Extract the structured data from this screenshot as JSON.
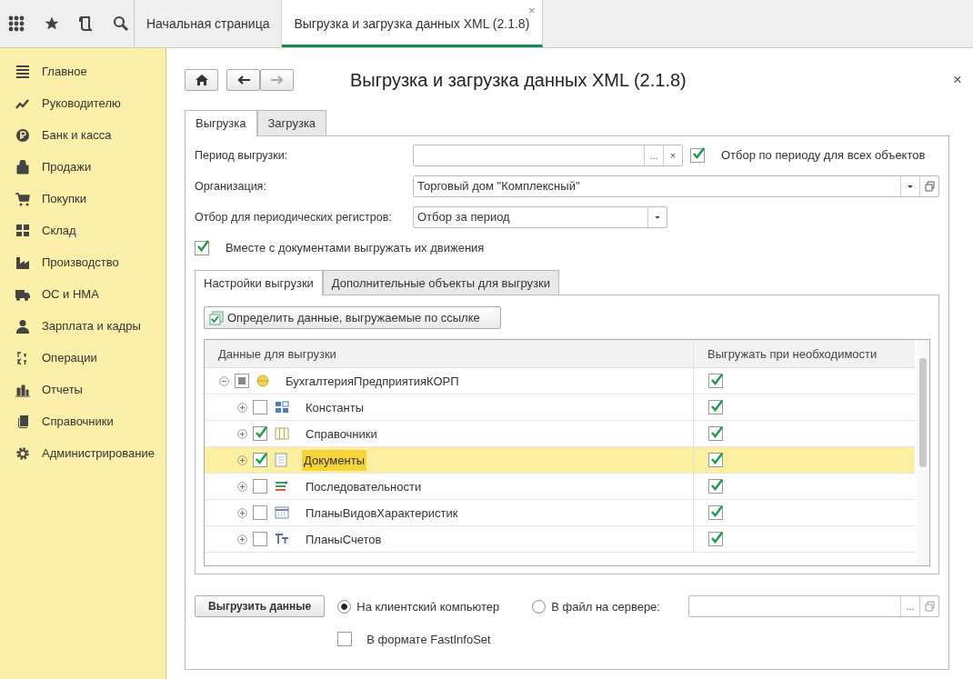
{
  "tabs": [
    {
      "label": "Начальная страница",
      "selected": false
    },
    {
      "label": "Выгрузка и загрузка данных XML (2.1.8)",
      "selected": true,
      "close": "×"
    }
  ],
  "sidebar": {
    "items": [
      {
        "label": "Главное",
        "kind": "menu"
      },
      {
        "label": "Руководителю",
        "kind": "trend"
      },
      {
        "label": "Банк и касса",
        "kind": "ruble"
      },
      {
        "label": "Продажи",
        "kind": "bag"
      },
      {
        "label": "Покупки",
        "kind": "cart"
      },
      {
        "label": "Склад",
        "kind": "blocks"
      },
      {
        "label": "Производство",
        "kind": "factory"
      },
      {
        "label": "ОС и НМА",
        "kind": "truck"
      },
      {
        "label": "Зарплата и кадры",
        "kind": "person"
      },
      {
        "label": "Операции",
        "kind": "dtkt"
      },
      {
        "label": "Отчеты",
        "kind": "chart"
      },
      {
        "label": "Справочники",
        "kind": "pages"
      },
      {
        "label": "Администрирование",
        "kind": "gear"
      }
    ]
  },
  "form": {
    "title": "Выгрузка и загрузка данных XML (2.1.8)",
    "close": "×",
    "tabs": [
      {
        "label": "Выгрузка",
        "selected": true
      },
      {
        "label": "Загрузка",
        "selected": false
      }
    ],
    "period": {
      "label": "Период выгрузки:",
      "choose": "...",
      "clear": "×",
      "filter_all": {
        "label": "Отбор по периоду для всех объектов",
        "checked": true
      }
    },
    "organization": {
      "label": "Организация:",
      "value": "Торговый дом \"Комплексный\""
    },
    "periodic_filter": {
      "label": "Отбор для периодических регистров:",
      "value": "Отбор за период"
    },
    "with_movements": {
      "label": "Вместе с документами выгружать их движения",
      "checked": true
    },
    "inner_tabs": [
      {
        "label": "Настройки выгрузки",
        "selected": true
      },
      {
        "label": "Дополнительные объекты для выгрузки",
        "selected": false
      }
    ],
    "define_button": "Определить данные, выгружаемые по ссылке",
    "table": {
      "columns": [
        "Данные для выгрузки",
        "Выгружать при необходимости"
      ],
      "rows": [
        {
          "label": "БухгалтерияПредприятияКОРП",
          "kind": "config",
          "expanded": true,
          "checked": false,
          "indeterminate": true,
          "export_needed": true,
          "selected": false,
          "children": [
            {
              "label": "Константы",
              "kind": "constants",
              "expanded": false,
              "checked": false,
              "export_needed": true,
              "selected": false
            },
            {
              "label": "Справочники",
              "kind": "catalogs",
              "expanded": false,
              "checked": true,
              "export_needed": true,
              "selected": false
            },
            {
              "label": "Документы",
              "kind": "documents",
              "expanded": false,
              "checked": true,
              "export_needed": true,
              "selected": true
            },
            {
              "label": "Последовательности",
              "kind": "sequences",
              "expanded": false,
              "checked": false,
              "export_needed": true,
              "selected": false
            },
            {
              "label": "ПланыВидовХарактеристик",
              "kind": "characteristics",
              "expanded": false,
              "checked": false,
              "export_needed": true,
              "selected": false
            },
            {
              "label": "ПланыСчетов",
              "kind": "accounts",
              "expanded": false,
              "checked": false,
              "export_needed": true,
              "selected": false
            }
          ]
        }
      ]
    },
    "export_button": "Выгрузить данные",
    "targets": [
      {
        "label": "На клиентский компьютер",
        "selected": true
      },
      {
        "label": "В файл на сервере:",
        "selected": false
      }
    ],
    "server_file": {
      "choose": "..."
    },
    "fast_infoset": {
      "label": "В формате FastInfoSet",
      "checked": false
    }
  }
}
